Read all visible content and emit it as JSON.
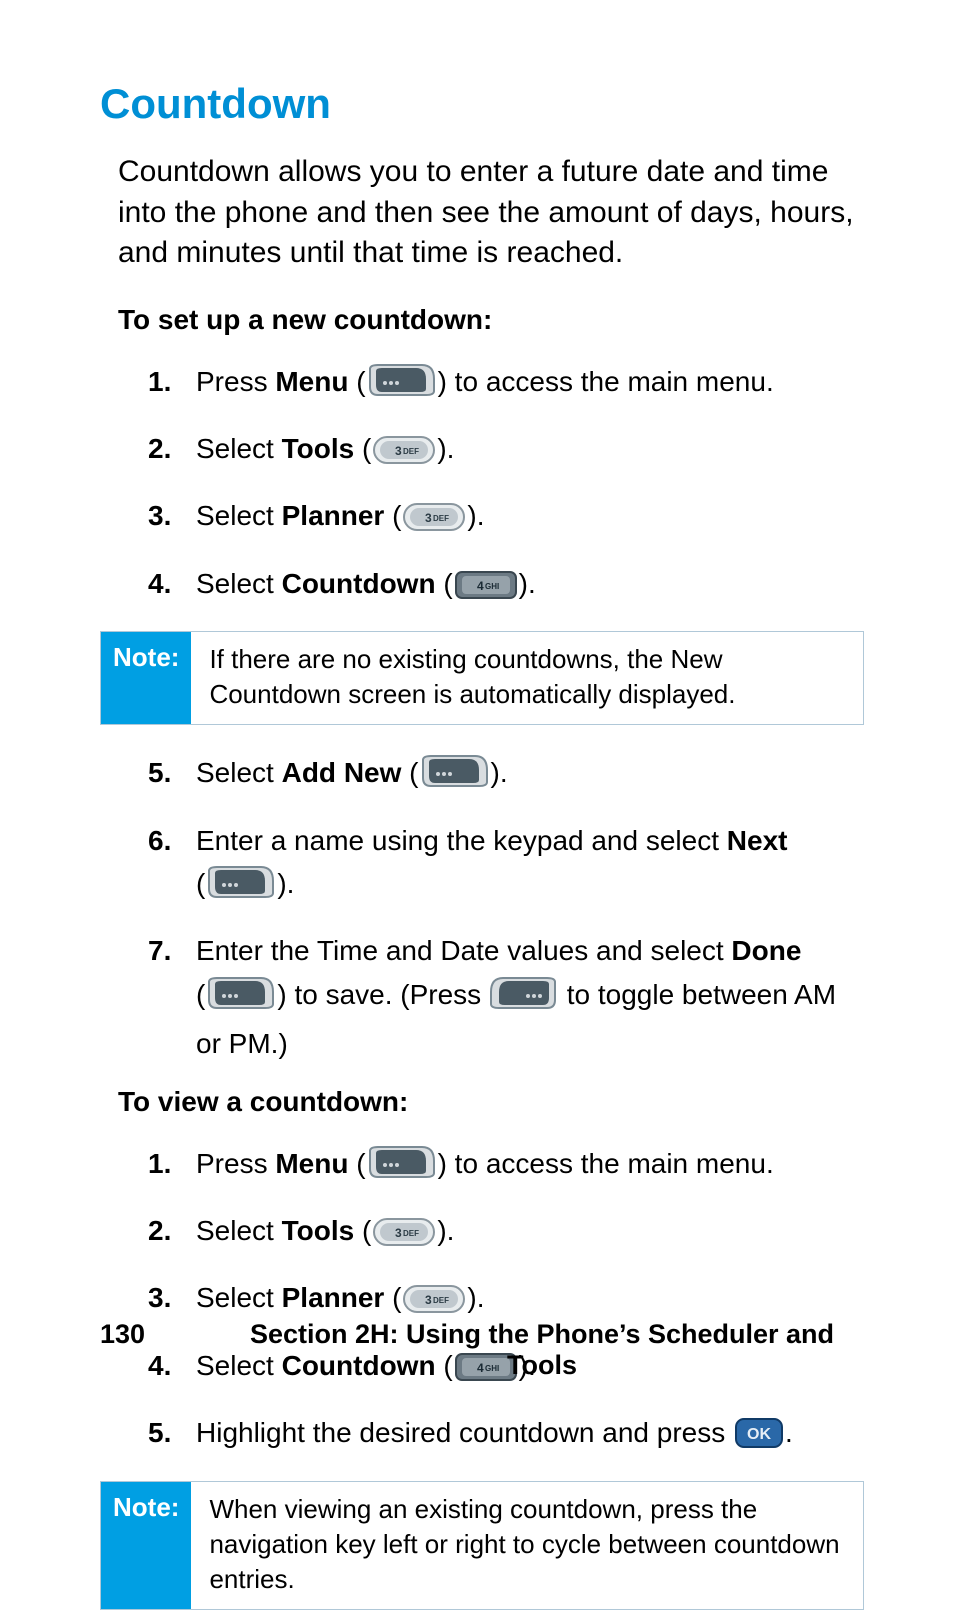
{
  "heading": "Countdown",
  "intro": "Countdown allows you to enter a future date and time into the phone and then see the amount of days, hours, and minutes until that time is reached.",
  "subhead_setup": "To set up a new countdown:",
  "subhead_view": "To view a countdown:",
  "steps_setup": {
    "s1_a": "Press ",
    "s1_b": "Menu",
    "s1_c": " (",
    "s1_d": ") to access the main menu.",
    "s2_a": "Select ",
    "s2_b": "Tools",
    "s2_c": " (",
    "s2_d": ").",
    "s3_a": "Select ",
    "s3_b": "Planner",
    "s3_c": " (",
    "s3_d": ").",
    "s4_a": "Select ",
    "s4_b": "Countdown",
    "s4_c": " (",
    "s4_d": ").",
    "s5_a": "Select ",
    "s5_b": "Add New",
    "s5_c": " (",
    "s5_d": ").",
    "s6_a": "Enter a name using the keypad and select ",
    "s6_b": "Next",
    "s6_c": " (",
    "s6_d": ").",
    "s7_a": "Enter the Time and Date values and select ",
    "s7_b": "Done",
    "s7_c": " (",
    "s7_d": ")",
    "s7_e": "to save. (Press ",
    "s7_f": " to toggle between AM or PM.)"
  },
  "steps_view": {
    "v1_a": "Press ",
    "v1_b": "Menu",
    "v1_c": " (",
    "v1_d": ") to access the main menu.",
    "v2_a": "Select ",
    "v2_b": "Tools",
    "v2_c": " (",
    "v2_d": ").",
    "v3_a": "Select ",
    "v3_b": "Planner",
    "v3_c": " (",
    "v3_d": ").",
    "v4_a": "Select ",
    "v4_b": "Countdown",
    "v4_c": " (",
    "v4_d": ").",
    "v5_a": "Highlight the desired countdown and press ",
    "v5_b": "."
  },
  "numbers": {
    "n1": "1.",
    "n2": "2.",
    "n3": "3.",
    "n4": "4.",
    "n5": "5.",
    "n6": "6.",
    "n7": "7."
  },
  "note1_label": "Note:",
  "note1_text": "If there are no existing countdowns, the New Countdown screen is automatically displayed.",
  "note2_label": "Note:",
  "note2_text": "When viewing an existing countdown, press the navigation key left or right to cycle between countdown entries.",
  "footer_page": "130",
  "footer_section": "Section 2H: Using the Phone’s Scheduler and Tools",
  "icons": {
    "menu": "menu-softkey-icon",
    "key3": "key-3-def-icon",
    "key4": "key-4-ghi-icon",
    "right": "right-softkey-icon",
    "ok": "ok-button-icon"
  }
}
